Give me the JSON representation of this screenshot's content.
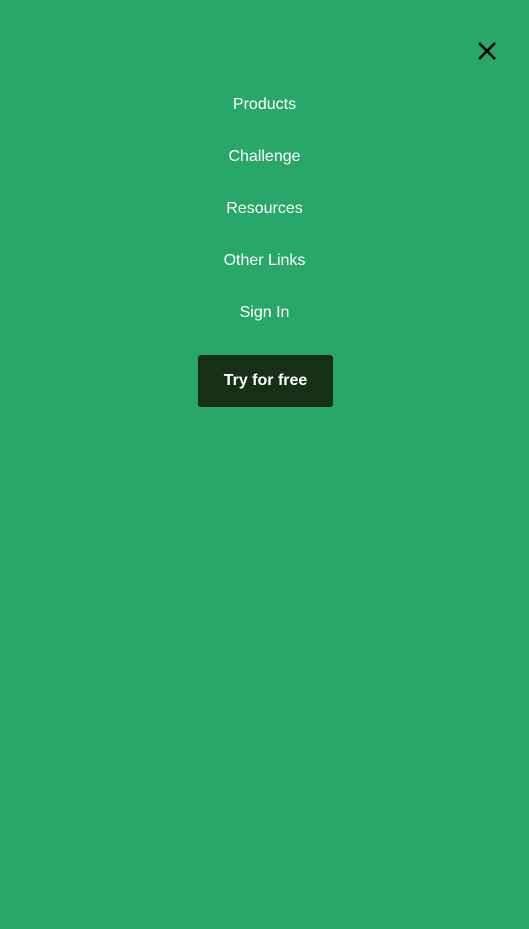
{
  "menu": {
    "close_icon": "close-icon",
    "items": [
      {
        "label": "Products"
      },
      {
        "label": "Challenge"
      },
      {
        "label": "Resources"
      },
      {
        "label": "Other Links"
      },
      {
        "label": "Sign In"
      }
    ],
    "cta_label": "Try for free"
  },
  "colors": {
    "background": "#29a769",
    "cta_background": "#163018",
    "text": "#ffffff"
  }
}
